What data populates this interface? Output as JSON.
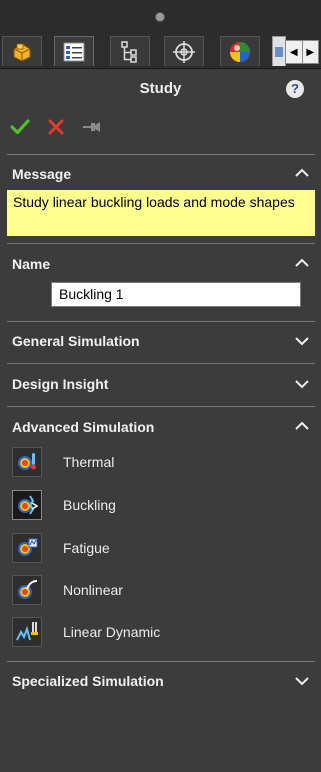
{
  "header": {
    "tabs": [
      {
        "icon": "part-feature-icon"
      },
      {
        "icon": "property-manager-icon"
      },
      {
        "icon": "configuration-manager-icon"
      },
      {
        "icon": "dimxpert-icon"
      },
      {
        "icon": "display-manager-icon"
      }
    ],
    "scroll_left": "◀",
    "scroll_right": "▶"
  },
  "panel": {
    "title": "Study",
    "help_label": "?"
  },
  "actions": [
    "ok-check-icon",
    "cancel-x-icon",
    "pushpin-icon"
  ],
  "message": {
    "header": "Message",
    "text": "Study linear buckling loads and mode shapes"
  },
  "name": {
    "header": "Name",
    "value": "Buckling 1"
  },
  "sections": {
    "general": "General Simulation",
    "design": "Design Insight",
    "advanced": "Advanced Simulation",
    "specialized": "Specialized Simulation"
  },
  "advanced_items": [
    {
      "label": "Thermal",
      "icon": "thermal-study-icon",
      "selected": false
    },
    {
      "label": "Buckling",
      "icon": "buckling-study-icon",
      "selected": true
    },
    {
      "label": "Fatigue",
      "icon": "fatigue-study-icon",
      "selected": false
    },
    {
      "label": "Nonlinear",
      "icon": "nonlinear-study-icon",
      "selected": false
    },
    {
      "label": "Linear Dynamic",
      "icon": "linear-dynamic-study-icon",
      "selected": false
    }
  ],
  "colors": {
    "background": "#3c3c3c",
    "message_bg": "#ffff90",
    "ok": "#4fc02c",
    "cancel": "#e03a2a"
  }
}
